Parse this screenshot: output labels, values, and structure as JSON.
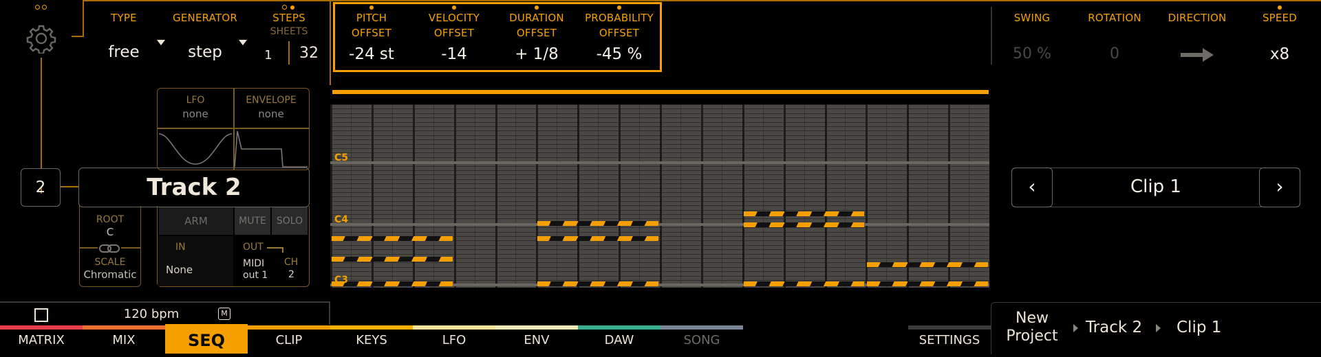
{
  "colors": {
    "accent": "#f5a000",
    "grid": "#4a4844",
    "note": "#f5a000"
  },
  "seq": {
    "type": {
      "label": "TYPE",
      "value": "free"
    },
    "generator": {
      "label": "GENERATOR",
      "value": "step"
    },
    "steps": {
      "label": "STEPS",
      "sublabel": "SHEETS",
      "value_a": "1",
      "value_b": "32"
    },
    "offsets": [
      {
        "line1": "PITCH",
        "line2": "OFFSET",
        "value": "-24 st"
      },
      {
        "line1": "VELOCITY",
        "line2": "OFFSET",
        "value": "-14"
      },
      {
        "line1": "DURATION",
        "line2": "OFFSET",
        "value": "+ 1/8"
      },
      {
        "line1": "PROBABILITY",
        "line2": "OFFSET",
        "value": "-45 %"
      }
    ],
    "swing": {
      "label": "SWING",
      "value": "50 %"
    },
    "rotation": {
      "label": "ROTATION",
      "value": "0"
    },
    "direction": {
      "label": "DIRECTION",
      "icon": "arrow-right-icon"
    },
    "speed": {
      "label": "SPEED",
      "value": "x8"
    }
  },
  "track": {
    "number": "2",
    "name": "Track 2",
    "lfo": {
      "label": "LFO",
      "value": "none"
    },
    "envelope": {
      "label": "ENVELOPE",
      "value": "none"
    },
    "arm": "ARM",
    "mute": "MUTE",
    "solo": "SOLO",
    "in_label": "IN",
    "in_value": "None",
    "out_label": "OUT",
    "out_line1": "MIDI",
    "out_line2": "out 1",
    "ch_label": "CH",
    "ch_value": "2",
    "root_label": "ROOT",
    "root_value": "C",
    "scale_label": "SCALE",
    "scale_value": "Chromatic"
  },
  "grid": {
    "note_labels": [
      "C5",
      "C4",
      "C3"
    ]
  },
  "clip": {
    "name": "Clip 1",
    "prev": "‹",
    "next": "›"
  },
  "transport": {
    "bpm": "120 bpm",
    "m_badge": "M"
  },
  "tabs": [
    {
      "label": "MATRIX",
      "color": "#e8404a"
    },
    {
      "label": "MIX",
      "color": "#ee7030"
    },
    {
      "label": "SEQ",
      "color": "#f5a000"
    },
    {
      "label": "CLIP",
      "color": "#f5a000"
    },
    {
      "label": "KEYS",
      "color": "#f6b000"
    },
    {
      "label": "LFO",
      "color": "#f7e49a"
    },
    {
      "label": "ENV",
      "color": "#efe9b8"
    },
    {
      "label": "DAW",
      "color": "#3aae90"
    },
    {
      "label": "SONG",
      "color": "#7b8494"
    }
  ],
  "settings": "SETTINGS",
  "breadcrumb": {
    "project_line1": "New",
    "project_line2": "Project",
    "track": "Track 2",
    "clip": "Clip 1"
  }
}
